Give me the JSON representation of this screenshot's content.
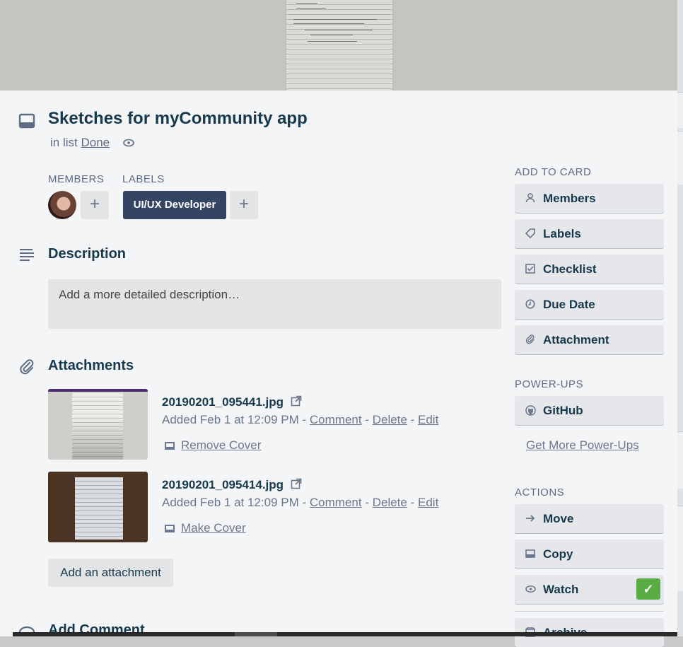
{
  "card": {
    "title": "Sketches for myCommunity app",
    "in_list_prefix": "in list",
    "list_name": "Done"
  },
  "members": {
    "label": "Members",
    "add_symbol": "+"
  },
  "labels": {
    "label": "Labels",
    "chips": [
      "UI/UX Developer"
    ],
    "add_symbol": "+"
  },
  "description": {
    "heading": "Description",
    "placeholder": "Add a more detailed description…"
  },
  "attachments": {
    "heading": "Attachments",
    "items": [
      {
        "name": "20190201_095441.jpg",
        "added": "Added Feb 1 at 12:09 PM",
        "comment": "Comment",
        "delete": "Delete",
        "edit": "Edit",
        "cover_action": "Remove Cover"
      },
      {
        "name": "20190201_095414.jpg",
        "added": "Added Feb 1 at 12:09 PM",
        "comment": "Comment",
        "delete": "Delete",
        "edit": "Edit",
        "cover_action": "Make Cover"
      }
    ],
    "add_button": "Add an attachment",
    "separator": "-"
  },
  "comment": {
    "heading": "Add Comment"
  },
  "sidebar": {
    "add_to_card_label": "Add to card",
    "add_to_card": [
      {
        "label": "Members",
        "icon": "person-icon"
      },
      {
        "label": "Labels",
        "icon": "tag-icon"
      },
      {
        "label": "Checklist",
        "icon": "checkbox-icon"
      },
      {
        "label": "Due Date",
        "icon": "clock-icon"
      },
      {
        "label": "Attachment",
        "icon": "paperclip-icon"
      }
    ],
    "power_ups_label": "Power-Ups",
    "power_ups": [
      {
        "label": "GitHub",
        "icon": "github-icon"
      }
    ],
    "get_more_power_ups": "Get More Power-Ups",
    "actions_label": "Actions",
    "actions": [
      {
        "label": "Move",
        "icon": "arrow-right-icon"
      },
      {
        "label": "Copy",
        "icon": "card-icon"
      },
      {
        "label": "Watch",
        "icon": "eye-icon",
        "checked": true
      },
      {
        "label": "Archive",
        "icon": "archive-icon"
      }
    ]
  },
  "colors": {
    "label_chip": "#344563",
    "watch_check": "#5aac44",
    "card_bg": "#f4f5f7",
    "heading": "#17394d"
  }
}
